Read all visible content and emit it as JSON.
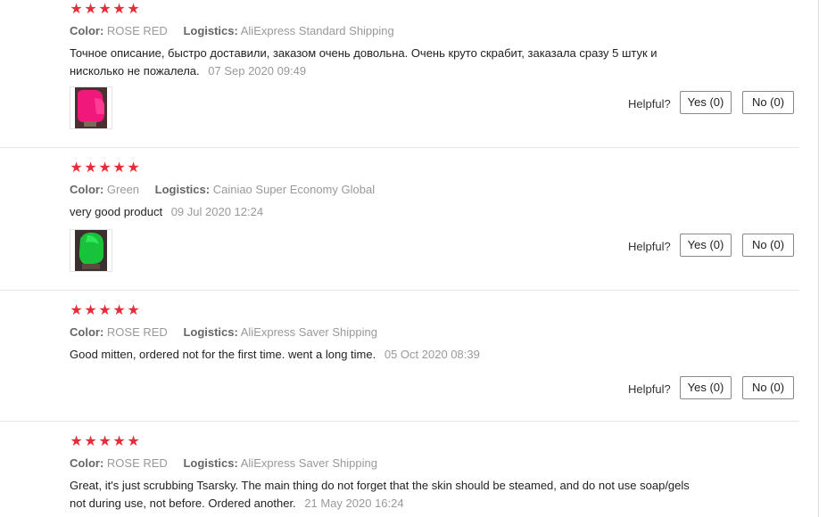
{
  "labels": {
    "color": "Color:",
    "logistics": "Logistics:",
    "helpful": "Helpful?"
  },
  "star_color": "#e62e3a",
  "reviews": [
    {
      "rating": 5,
      "color": "ROSE RED",
      "logistics": "AliExpress Standard Shipping",
      "text": "Точное описание, быстро доставили, заказом очень довольна. Очень круто скрабит, заказала сразу 5 штук и нисколько не пожалела.",
      "date": "07 Sep 2020 09:49",
      "photo": "pink-mitten-photo",
      "yes": "Yes (0)",
      "no": "No (0)"
    },
    {
      "rating": 5,
      "color": "Green",
      "logistics": "Cainiao Super Economy Global",
      "text": "very good product",
      "date": "09 Jul 2020 12:24",
      "photo": "green-mitten-photo",
      "yes": "Yes (0)",
      "no": "No (0)"
    },
    {
      "rating": 5,
      "color": "ROSE RED",
      "logistics": "AliExpress Saver Shipping",
      "text": "Good mitten, ordered not for the first time. went a long time.",
      "date": "05 Oct 2020 08:39",
      "yes": "Yes (0)",
      "no": "No (0)"
    },
    {
      "rating": 5,
      "color": "ROSE RED",
      "logistics": "AliExpress Saver Shipping",
      "text": "Great, it's just scrubbing Tsarsky. The main thing do not forget that the skin should be steamed, and do not use soap/gels not during use, not before. Ordered another.",
      "date": "21 May 2020 16:24"
    }
  ]
}
